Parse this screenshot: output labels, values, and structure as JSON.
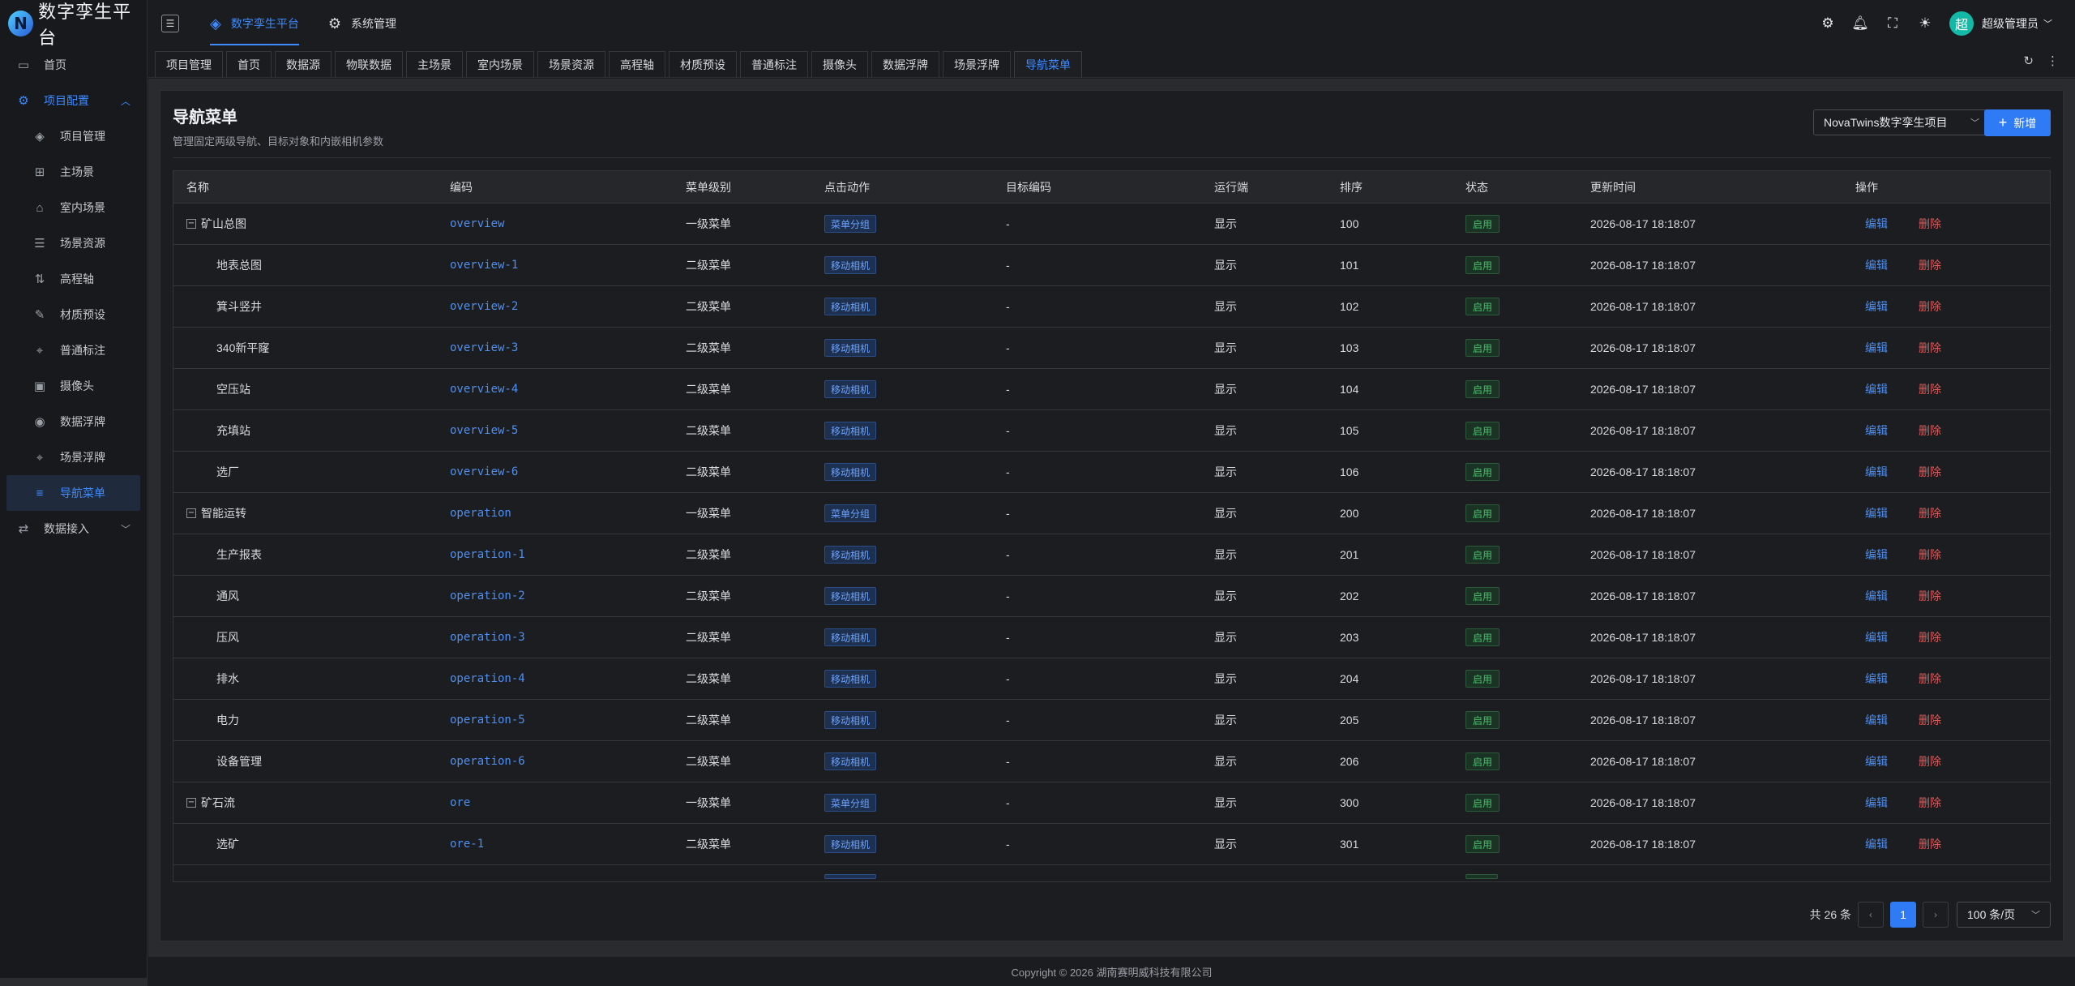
{
  "app": {
    "logo_letter": "N",
    "title": "数字孪生平台"
  },
  "header": {
    "tabs": [
      {
        "label": "数字孪生平台",
        "icon": "layers-icon",
        "active": true
      },
      {
        "label": "系统管理",
        "icon": "gear-icon",
        "active": false
      }
    ],
    "user": {
      "avatar_text": "超",
      "name": "超级管理员"
    }
  },
  "sidebar": {
    "home": "首页",
    "project_config": "项目配置",
    "items": [
      {
        "label": "项目管理",
        "icon": "layers-icon"
      },
      {
        "label": "主场景",
        "icon": "grid-icon"
      },
      {
        "label": "室内场景",
        "icon": "building-icon"
      },
      {
        "label": "场景资源",
        "icon": "list-icon"
      },
      {
        "label": "高程轴",
        "icon": "elevation-icon"
      },
      {
        "label": "材质预设",
        "icon": "brush-icon"
      },
      {
        "label": "普通标注",
        "icon": "pin-icon"
      },
      {
        "label": "摄像头",
        "icon": "camera-icon"
      },
      {
        "label": "数据浮牌",
        "icon": "board-icon"
      },
      {
        "label": "场景浮牌",
        "icon": "pin-icon"
      },
      {
        "label": "导航菜单",
        "icon": "menu-icon",
        "active": true
      }
    ],
    "data_access": "数据接入"
  },
  "tabbar": {
    "tabs": [
      "项目管理",
      "首页",
      "数据源",
      "物联数据",
      "主场景",
      "室内场景",
      "场景资源",
      "高程轴",
      "材质预设",
      "普通标注",
      "摄像头",
      "数据浮牌",
      "场景浮牌",
      "导航菜单"
    ],
    "active_index": 13
  },
  "page": {
    "title": "导航菜单",
    "description": "管理固定两级导航、目标对象和内嵌相机参数",
    "project_select": "NovaTwins数字孪生项目",
    "add_button": "新增"
  },
  "table": {
    "columns": [
      "名称",
      "编码",
      "菜单级别",
      "点击动作",
      "目标编码",
      "运行端",
      "排序",
      "状态",
      "更新时间",
      "操作"
    ],
    "ops": {
      "edit": "编辑",
      "delete": "删除"
    },
    "rows": [
      {
        "name": "矿山总图",
        "group": true,
        "code": "overview",
        "level": "一级菜单",
        "action": "菜单分组",
        "target": "-",
        "client": "显示",
        "sort": "100",
        "status": "启用",
        "time": "2026-08-17 18:18:07"
      },
      {
        "name": "地表总图",
        "group": false,
        "code": "overview-1",
        "level": "二级菜单",
        "action": "移动相机",
        "target": "-",
        "client": "显示",
        "sort": "101",
        "status": "启用",
        "time": "2026-08-17 18:18:07"
      },
      {
        "name": "箕斗竖井",
        "group": false,
        "code": "overview-2",
        "level": "二级菜单",
        "action": "移动相机",
        "target": "-",
        "client": "显示",
        "sort": "102",
        "status": "启用",
        "time": "2026-08-17 18:18:07"
      },
      {
        "name": "340新平窿",
        "group": false,
        "code": "overview-3",
        "level": "二级菜单",
        "action": "移动相机",
        "target": "-",
        "client": "显示",
        "sort": "103",
        "status": "启用",
        "time": "2026-08-17 18:18:07"
      },
      {
        "name": "空压站",
        "group": false,
        "code": "overview-4",
        "level": "二级菜单",
        "action": "移动相机",
        "target": "-",
        "client": "显示",
        "sort": "104",
        "status": "启用",
        "time": "2026-08-17 18:18:07"
      },
      {
        "name": "充填站",
        "group": false,
        "code": "overview-5",
        "level": "二级菜单",
        "action": "移动相机",
        "target": "-",
        "client": "显示",
        "sort": "105",
        "status": "启用",
        "time": "2026-08-17 18:18:07"
      },
      {
        "name": "选厂",
        "group": false,
        "code": "overview-6",
        "level": "二级菜单",
        "action": "移动相机",
        "target": "-",
        "client": "显示",
        "sort": "106",
        "status": "启用",
        "time": "2026-08-17 18:18:07"
      },
      {
        "name": "智能运转",
        "group": true,
        "code": "operation",
        "level": "一级菜单",
        "action": "菜单分组",
        "target": "-",
        "client": "显示",
        "sort": "200",
        "status": "启用",
        "time": "2026-08-17 18:18:07"
      },
      {
        "name": "生产报表",
        "group": false,
        "code": "operation-1",
        "level": "二级菜单",
        "action": "移动相机",
        "target": "-",
        "client": "显示",
        "sort": "201",
        "status": "启用",
        "time": "2026-08-17 18:18:07"
      },
      {
        "name": "通风",
        "group": false,
        "code": "operation-2",
        "level": "二级菜单",
        "action": "移动相机",
        "target": "-",
        "client": "显示",
        "sort": "202",
        "status": "启用",
        "time": "2026-08-17 18:18:07"
      },
      {
        "name": "压风",
        "group": false,
        "code": "operation-3",
        "level": "二级菜单",
        "action": "移动相机",
        "target": "-",
        "client": "显示",
        "sort": "203",
        "status": "启用",
        "time": "2026-08-17 18:18:07"
      },
      {
        "name": "排水",
        "group": false,
        "code": "operation-4",
        "level": "二级菜单",
        "action": "移动相机",
        "target": "-",
        "client": "显示",
        "sort": "204",
        "status": "启用",
        "time": "2026-08-17 18:18:07"
      },
      {
        "name": "电力",
        "group": false,
        "code": "operation-5",
        "level": "二级菜单",
        "action": "移动相机",
        "target": "-",
        "client": "显示",
        "sort": "205",
        "status": "启用",
        "time": "2026-08-17 18:18:07"
      },
      {
        "name": "设备管理",
        "group": false,
        "code": "operation-6",
        "level": "二级菜单",
        "action": "移动相机",
        "target": "-",
        "client": "显示",
        "sort": "206",
        "status": "启用",
        "time": "2026-08-17 18:18:07"
      },
      {
        "name": "矿石流",
        "group": true,
        "code": "ore",
        "level": "一级菜单",
        "action": "菜单分组",
        "target": "-",
        "client": "显示",
        "sort": "300",
        "status": "启用",
        "time": "2026-08-17 18:18:07"
      },
      {
        "name": "选矿",
        "group": false,
        "code": "ore-1",
        "level": "二级菜单",
        "action": "移动相机",
        "target": "-",
        "client": "显示",
        "sort": "301",
        "status": "启用",
        "time": "2026-08-17 18:18:07"
      }
    ]
  },
  "pagination": {
    "total": "共 26 条",
    "current_page": "1",
    "page_size": "100 条/页"
  },
  "footer": {
    "copyright": "Copyright © 2026 湖南赛明威科技有限公司"
  },
  "colors": {
    "accent": "#2f7bf5",
    "link": "#4e8ff0",
    "danger": "#e05a5a",
    "success": "#47c26a",
    "avatar": "#14b8a6"
  }
}
